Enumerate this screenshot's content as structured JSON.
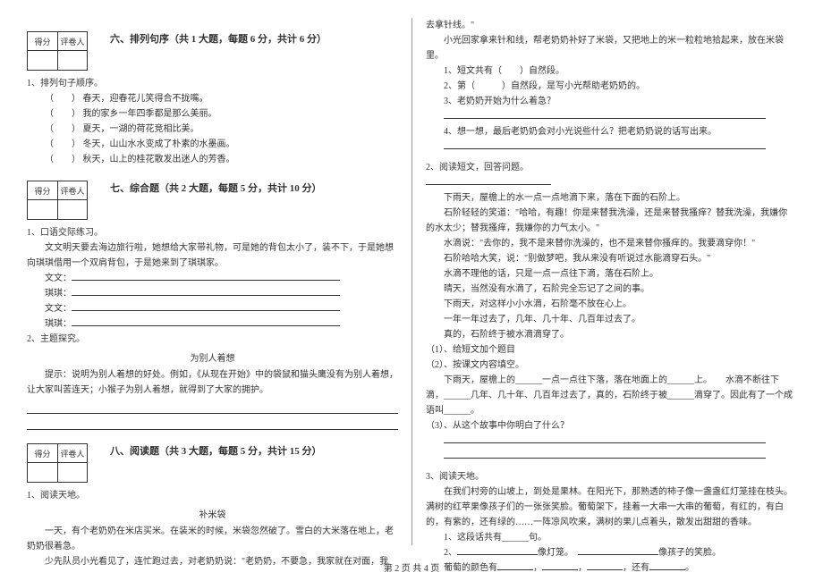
{
  "scorebox": {
    "score_label": "得分",
    "reviewer_label": "评卷人"
  },
  "sec6": {
    "title": "六、排列句序（共 1 大题，每题 6 分，共计 6 分）",
    "q1_stem": "1、排列句子顺序。",
    "lines": [
      "（　　） 春天，迎春花儿笑得合不拢嘴。",
      "（　　） 我的家乡一年四季都是那么美丽。",
      "（　　） 夏天，一湖的荷花竞相比美。",
      "（　　） 冬天，山山水水变成了朴素的水墨画。",
      "（　　） 秋天，山上的桂花散发出迷人的芳香。"
    ]
  },
  "sec7": {
    "title": "七、综合题（共 2 大题，每题 5 分，共计 10 分）",
    "q1_stem": "1、口语交际练习。",
    "q1_body": "　　文文明天要去海边旅行啦，她想给大家带礼物，可是她的背包太小了，装不下，于是她想向琪琪借用一个双肩背包，于是她来到了琪琪家。",
    "dlg": [
      {
        "who": "文文：",
        "blank": true
      },
      {
        "who": "琪琪：",
        "blank": true
      },
      {
        "who": "文文：",
        "blank": true
      },
      {
        "who": "琪琪：",
        "blank": true
      }
    ],
    "q2_stem": "2、主题探究。",
    "q2_center": "为别人着想",
    "q2_body": "　　提示：说明为别人着想的好处。例如，《从现在开始》中的袋鼠和猫头鹰没有为别人着想，让大家叫苦连天；小猴子为别人着想，就得到了大家的拥护。"
  },
  "sec8": {
    "title": "八、阅读题（共 3 大题，每题 5 分，共计 15 分）",
    "q1_stem": "1、阅读天地。",
    "q1_title": "补米袋",
    "q1_p1": "　　一天，有个老奶奶在米店买米。在装米的时候，米袋忽然破了。雪白的大米落在地上，老奶奶很着急。",
    "q1_p2": "　　少先队员小光看见了，连忙跑过去，对老奶奶说：\"老奶奶，不要急，我家就在对面，我"
  },
  "right": {
    "cont1": "去拿针线。\"",
    "cont2": "　　小光回家拿来针和线，帮老奶奶补好了米袋，又把地上的米一粒粒地拾起来，放在米袋里。",
    "sub1": "1、短文共有（　　）自然段。",
    "sub2": "2、第（　　　）自然段，是写小光帮助老奶奶的。",
    "sub3": "3、老奶奶开始为什么着急？",
    "sub4": "4、想一想，最后老奶奶会对小光说些什么？把老奶奶说的话写出来。",
    "q2_stem": "2、阅读短文，回答问题。",
    "passage": [
      "　　下雨天，屋檐上的水一点一点地滴下来，落在下面的石阶上。",
      "　　石阶轻轻的笑道：\"哈哈，有趣！你是来替我洗澡，还是来替我搔痒？替我洗澡，我嫌你的水太少；替我搔痒，我嫌你的力气太小。\"",
      "　　水滴说：\"去你的，我不是来替你洗澡的，也不是来替你搔痒的。我要滴穿你！\"",
      "　　石阶哈哈大笑，说：\"别做梦吧，我从来没有听说过水能滴穿石头。\"",
      "　　水滴不理他的话，只是一点一点往下滴，落在石阶上。",
      "　　晴天，当然没有水滴了，石阶完全忘记了之间的事。",
      "　　下雨天，对这样小小水滴，石阶毫不放在心上。",
      "　　一年一年过去了，几年、几十年、几百年过去了。",
      "　　真的，石阶终于被水滴滴穿了。"
    ],
    "s1": "（1）、给短文加个题目",
    "s2": "（2）、按课文内容填空。",
    "s2_fill": "　　下雨天，屋檐上的______一点一点往下落，落在地面上的______上。　　水滴不断往下滴，______几年、几十年、几百年过去了，真的，石阶终于被______滴穿了。因此有了一个成语叫______。",
    "s3": "（3）、从这个故事中你明白了什么？",
    "q3_stem": "3、阅读天地。",
    "q3_body": "　　在我们村旁的山坡上，到处是果林。在阳光下，那熟透的柿子像一盏盏红灯笼挂在枝头。满树的红苹果像孩子们的一张张笑脸。葡萄架下，挂着一大串一大串的葡萄，有红的，有白的，有紫的，还有绿的……一阵凉风吹来，满树的果儿点着头，散发出甜甜的香味。",
    "q3_s1": "1、这段话共有______句。",
    "q3_s2a_hint": "像灯笼。",
    "q3_s2b_hint": "像孩子的笑脸。",
    "q3_s3_label": "葡萄的颜色有",
    "q3_s3_tail": "，还有"
  },
  "footer": "第 2 页  共 4 页"
}
